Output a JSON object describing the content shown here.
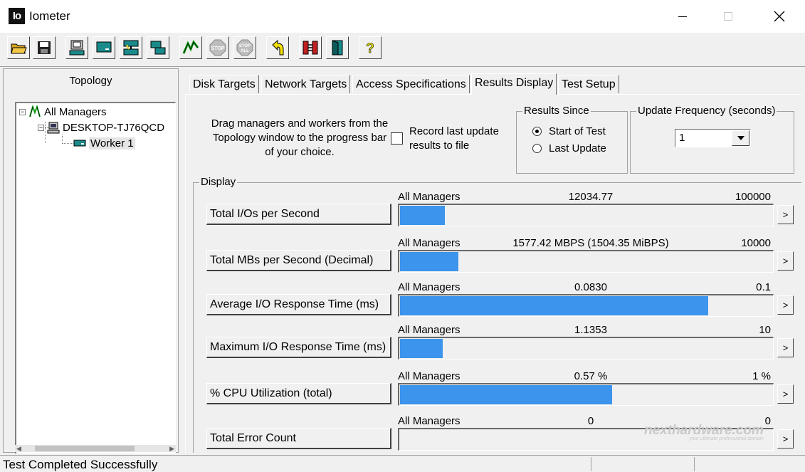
{
  "window": {
    "title": "Iometer",
    "logo_text": "Io"
  },
  "toolbar": {
    "buttons": [
      {
        "icon": "open-folder-icon"
      },
      {
        "icon": "save-icon"
      },
      {
        "icon": "start-disk-worker-icon"
      },
      {
        "icon": "start-network-worker-icon"
      },
      {
        "icon": "new-manager-icon"
      },
      {
        "icon": "duplicate-worker-icon"
      },
      {
        "icon": "start-tests-icon"
      },
      {
        "icon": "stop-icon",
        "label": "STOP"
      },
      {
        "icon": "stop-all-icon",
        "label": "STOP ALL"
      },
      {
        "icon": "reset-workers-icon"
      },
      {
        "icon": "disconnect-icon"
      },
      {
        "icon": "exit-icon"
      },
      {
        "icon": "help-icon",
        "label": "?"
      }
    ]
  },
  "topology": {
    "title": "Topology",
    "items": [
      {
        "label": "All Managers",
        "icon": "all-managers-icon"
      },
      {
        "label": "DESKTOP-TJ76QCD",
        "icon": "computer-icon"
      },
      {
        "label": "Worker 1",
        "icon": "disk-worker-icon"
      }
    ]
  },
  "tabs": [
    "Disk Targets",
    "Network Targets",
    "Access Specifications",
    "Results Display",
    "Test Setup"
  ],
  "active_tab": "Results Display",
  "results": {
    "hint": "Drag managers and workers from the Topology window to the progress bar of your choice.",
    "record_label": "Record last update results to file",
    "results_since": {
      "title": "Results Since",
      "options": [
        "Start of Test",
        "Last Update"
      ],
      "selected": "Start of Test"
    },
    "update_frequency": {
      "title": "Update Frequency (seconds)",
      "value": "1"
    },
    "display_title": "Display",
    "metrics": [
      {
        "label": "Total I/Os per Second",
        "manager": "All Managers",
        "value": "12034.77",
        "max": "100000",
        "fill": 0.12
      },
      {
        "label": "Total MBs per Second (Decimal)",
        "manager": "All Managers",
        "value": "1577.42 MBPS (1504.35 MiBPS)",
        "max": "10000",
        "fill": 0.158
      },
      {
        "label": "Average I/O Response Time (ms)",
        "manager": "All Managers",
        "value": "0.0830",
        "max": "0.1",
        "fill": 0.83
      },
      {
        "label": "Maximum I/O Response Time (ms)",
        "manager": "All Managers",
        "value": "1.1353",
        "max": "10",
        "fill": 0.114
      },
      {
        "label": "% CPU Utilization (total)",
        "manager": "All Managers",
        "value": "0.57 %",
        "max": "1 %",
        "fill": 0.57
      },
      {
        "label": "Total Error Count",
        "manager": "All Managers",
        "value": "0",
        "max": "0",
        "fill": 0
      }
    ],
    "more_label": ">"
  },
  "status": {
    "text": "Test Completed Successfully"
  },
  "watermark": {
    "text": "nexthardware.com",
    "tagline": "your ultimate professional domain"
  },
  "colors": {
    "bar": "#3c94ec"
  }
}
